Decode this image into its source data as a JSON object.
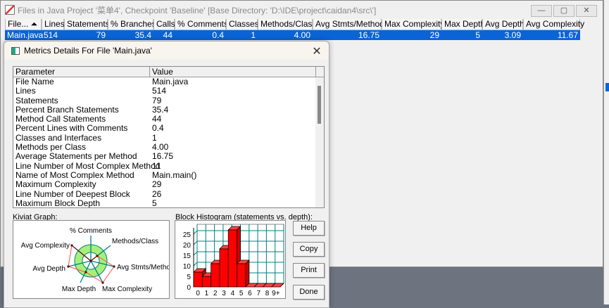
{
  "main": {
    "title": "Files in Java Project '菜单4', Checkpoint 'Baseline'  [Base Directory: 'D:\\IDE\\project\\caidan4\\src\\']",
    "window_buttons": [
      "—",
      "▢",
      "✕"
    ],
    "columns": [
      "File... ⏶",
      "Lines",
      "Statements",
      "% Branches",
      "Calls",
      "% Comments",
      "Classes",
      "Methods/Class",
      "Avg Stmts/Method",
      "Max Complexity",
      "Max Depth",
      "Avg Depth",
      "Avg Complexity"
    ],
    "row": [
      "Main.java",
      "514",
      "79",
      "35.4",
      "44",
      "0.4",
      "1",
      "4.00",
      "16.75",
      "29",
      "5",
      "3.09",
      "11.67"
    ]
  },
  "dialog": {
    "title": "Metrics Details For File 'Main.java'",
    "close": "✕",
    "list_headers": [
      "Parameter",
      "Value"
    ],
    "rows": [
      [
        "File Name",
        "Main.java"
      ],
      [
        "Lines",
        "514"
      ],
      [
        "Statements",
        "79"
      ],
      [
        "Percent Branch Statements",
        "35.4"
      ],
      [
        "Method Call Statements",
        "44"
      ],
      [
        "Percent Lines with Comments",
        "0.4"
      ],
      [
        "Classes and Interfaces",
        "1"
      ],
      [
        "Methods per Class",
        "4.00"
      ],
      [
        "Average Statements per Method",
        "16.75"
      ],
      [
        "Line Number of Most Complex Method",
        "11"
      ],
      [
        "Name of Most Complex Method",
        "Main.main()"
      ],
      [
        "Maximum Complexity",
        "29"
      ],
      [
        "Line Number of Deepest Block",
        "26"
      ],
      [
        "Maximum Block Depth",
        "5"
      ]
    ],
    "kiviat_label": "Kiviat Graph:",
    "kiviat_axes": [
      "% Comments",
      "Methods/Class",
      "Avg Stmts/Method",
      "Max Complexity",
      "Max Depth",
      "Avg Depth",
      "Avg Complexity"
    ],
    "histogram_label": "Block Histogram (statements vs. depth):",
    "buttons": [
      "Help",
      "Copy",
      "Print",
      "Done"
    ]
  },
  "chart_data": {
    "type": "bar",
    "categories": [
      "0",
      "1",
      "2",
      "3",
      "4",
      "5",
      "6",
      "7",
      "8",
      "9+"
    ],
    "values": [
      7,
      5,
      11,
      18,
      27,
      11,
      0,
      0,
      0,
      0
    ],
    "yticks": [
      "0",
      "5",
      "10",
      "15",
      "20",
      "25"
    ],
    "ylim": [
      0,
      28
    ],
    "grid": true,
    "bar_color": "#ff0000",
    "grid_color": "#008080"
  }
}
